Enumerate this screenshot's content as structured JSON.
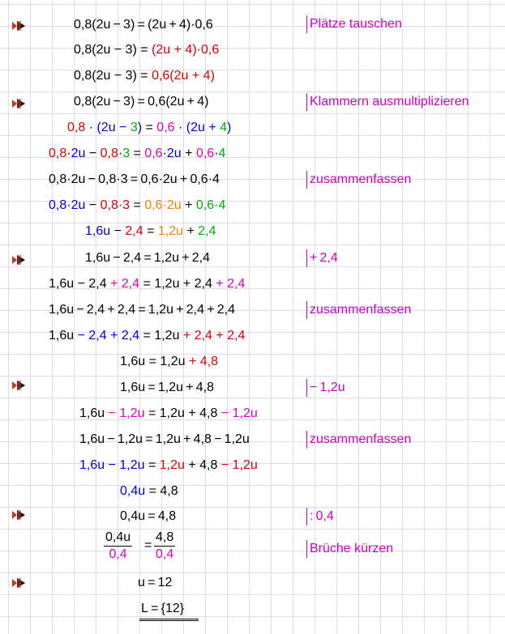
{
  "lines": [
    "0,8(2u − 3) = (2u + 4)·0,6",
    "0,8(2u − 3) = (2u + 4)·0,6",
    "0,8(2u − 3) = 0,6(2u + 4)",
    "0,8(2u − 3) = 0,6(2u + 4)",
    "0,8·(2u − 3) = 0,6·(2u + 4)",
    "0,8·2u − 0,8·3 = 0,6·2u + 0,6·4",
    "0,8·2u − 0,8·3 = 0,6·2u + 0,6·4",
    "0,8·2u − 0,8·3 = 0,6·2u + 0,6·4",
    "1,6u − 2,4 = 1,2u + 2,4",
    "1,6u − 2,4 = 1,2u + 2,4",
    "1,6u − 2,4 + 2,4 = 1,2u + 2,4 + 2,4",
    "1,6u − 2,4 + 2,4 = 1,2u + 2,4 + 2,4",
    "1,6u − 2,4 + 2,4 = 1,2u + 2,4 + 2,4",
    "1,6u = 1,2u + 4,8",
    "1,6u = 1,2u + 4,8",
    "1,6u − 1,2u = 1,2u + 4,8 − 1,2u",
    "1,6u − 1,2u = 1,2u + 4,8 − 1,2u",
    "1,6u − 1,2u = 1,2u + 4,8 − 1,2u",
    "0,4u = 4,8",
    "0,4u = 4,8",
    "",
    "u = 12",
    "L = {12}"
  ],
  "fraction": {
    "left_num": "0,4u",
    "left_den": "0,4",
    "right_num": "4,8",
    "right_den": "0,4",
    "eq": "="
  },
  "comments": {
    "c1": "Plätze tauschen",
    "c2": "Klammern ausmultiplizieren",
    "c3": "zusammenfassen",
    "c4": "+ 2,4",
    "c5": "zusammenfassen",
    "c6": "− 1,2u",
    "c7": "zusammenfassen",
    "c8": ": 0,4",
    "c9": "Brüche kürzen"
  },
  "colors": {
    "red": "#e00000",
    "magenta": "#e000c0",
    "blue": "#0000e0",
    "green": "#00b000",
    "orange": "#f08000",
    "grid": "#dcdcf0"
  },
  "icons": [
    "evaluate-arrow-icon"
  ]
}
